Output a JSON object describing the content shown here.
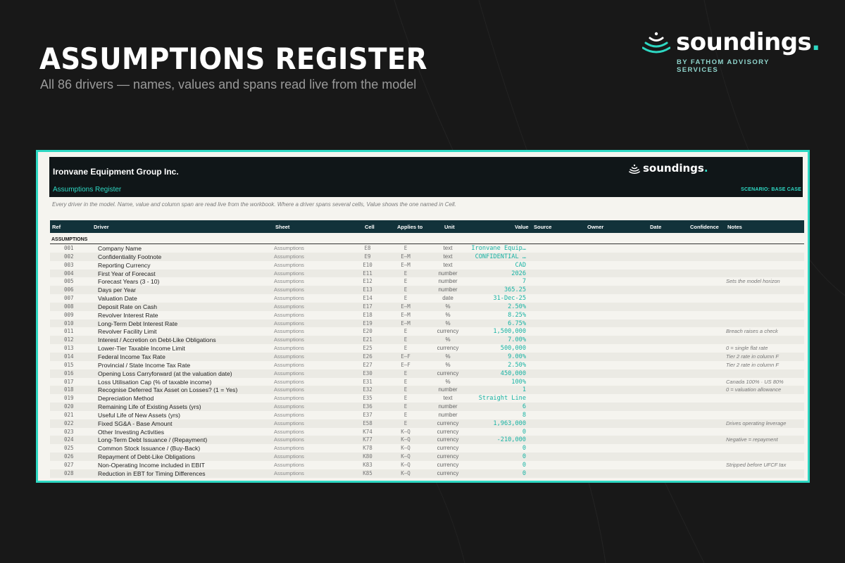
{
  "hero": {
    "title": "ASSUMPTIONS REGISTER",
    "subtitle": "All 86 drivers — names, values and spans read live from the model"
  },
  "brand": {
    "word": "soundings",
    "dot": ".",
    "sub": "BY FATHOM ADVISORY SERVICES",
    "icon": "sound-waves-icon",
    "accent": "#2ed8c3"
  },
  "sheet": {
    "company": "Ironvane Equipment Group Inc.",
    "register_link": "Assumptions Register",
    "scenario": "SCENARIO: BASE CASE",
    "note": "Every driver in the model. Name, value and column span are read live from the workbook. Where a driver spans several cells, Value shows the one named in Cell.",
    "columns": {
      "ref": "Ref",
      "driver": "Driver",
      "sheet": "Sheet",
      "cell": "Cell",
      "applies": "Applies to",
      "unit": "Unit",
      "value": "Value",
      "source": "Source",
      "owner": "Owner",
      "date": "Date",
      "confidence": "Confidence",
      "notes": "Notes"
    },
    "section": "ASSUMPTIONS",
    "rows": [
      {
        "ref": "001",
        "driver": "Company Name",
        "sheet": "Assumptions",
        "cell": "E8",
        "applies": "E",
        "unit": "text",
        "value": "Ironvane Equip…",
        "notes": ""
      },
      {
        "ref": "002",
        "driver": "Confidentiality Footnote",
        "sheet": "Assumptions",
        "cell": "E9",
        "applies": "E–M",
        "unit": "text",
        "value": "CONFIDENTIAL  …",
        "notes": ""
      },
      {
        "ref": "003",
        "driver": "Reporting Currency",
        "sheet": "Assumptions",
        "cell": "E10",
        "applies": "E–M",
        "unit": "text",
        "value": "CAD",
        "notes": ""
      },
      {
        "ref": "004",
        "driver": "First Year of Forecast",
        "sheet": "Assumptions",
        "cell": "E11",
        "applies": "E",
        "unit": "number",
        "value": "2026",
        "notes": ""
      },
      {
        "ref": "005",
        "driver": "Forecast Years  (3 - 10)",
        "sheet": "Assumptions",
        "cell": "E12",
        "applies": "E",
        "unit": "number",
        "value": "7",
        "notes": "Sets the model horizon"
      },
      {
        "ref": "006",
        "driver": "Days per Year",
        "sheet": "Assumptions",
        "cell": "E13",
        "applies": "E",
        "unit": "number",
        "value": "365.25",
        "notes": ""
      },
      {
        "ref": "007",
        "driver": "Valuation Date",
        "sheet": "Assumptions",
        "cell": "E14",
        "applies": "E",
        "unit": "date",
        "value": "31-Dec-25",
        "notes": ""
      },
      {
        "ref": "008",
        "driver": "Deposit Rate on Cash",
        "sheet": "Assumptions",
        "cell": "E17",
        "applies": "E–M",
        "unit": "%",
        "value": "2.50%",
        "notes": ""
      },
      {
        "ref": "009",
        "driver": "Revolver Interest Rate",
        "sheet": "Assumptions",
        "cell": "E18",
        "applies": "E–M",
        "unit": "%",
        "value": "8.25%",
        "notes": ""
      },
      {
        "ref": "010",
        "driver": "Long-Term Debt Interest Rate",
        "sheet": "Assumptions",
        "cell": "E19",
        "applies": "E–M",
        "unit": "%",
        "value": "6.75%",
        "notes": ""
      },
      {
        "ref": "011",
        "driver": "Revolver Facility Limit",
        "sheet": "Assumptions",
        "cell": "E20",
        "applies": "E",
        "unit": "currency",
        "value": "1,500,000",
        "notes": "Breach raises a check"
      },
      {
        "ref": "012",
        "driver": "Interest / Accretion on Debt-Like Obligations",
        "sheet": "Assumptions",
        "cell": "E21",
        "applies": "E",
        "unit": "%",
        "value": "7.00%",
        "notes": ""
      },
      {
        "ref": "013",
        "driver": "Lower-Tier Taxable Income Limit",
        "sheet": "Assumptions",
        "cell": "E25",
        "applies": "E",
        "unit": "currency",
        "value": "500,000",
        "notes": "0 = single flat rate"
      },
      {
        "ref": "014",
        "driver": "Federal Income Tax Rate",
        "sheet": "Assumptions",
        "cell": "E26",
        "applies": "E–F",
        "unit": "%",
        "value": "9.00%",
        "notes": "Tier 2 rate in column F"
      },
      {
        "ref": "015",
        "driver": "Provincial / State Income Tax Rate",
        "sheet": "Assumptions",
        "cell": "E27",
        "applies": "E–F",
        "unit": "%",
        "value": "2.50%",
        "notes": "Tier 2 rate in column F"
      },
      {
        "ref": "016",
        "driver": "Opening Loss Carryforward  (at the valuation date)",
        "sheet": "Assumptions",
        "cell": "E30",
        "applies": "E",
        "unit": "currency",
        "value": "450,000",
        "notes": ""
      },
      {
        "ref": "017",
        "driver": "Loss Utilisation Cap  (% of taxable income)",
        "sheet": "Assumptions",
        "cell": "E31",
        "applies": "E",
        "unit": "%",
        "value": "100%",
        "notes": "Canada 100% · US 80%"
      },
      {
        "ref": "018",
        "driver": "Recognise Deferred Tax Asset on Losses?  (1 = Yes)",
        "sheet": "Assumptions",
        "cell": "E32",
        "applies": "E",
        "unit": "number",
        "value": "1",
        "notes": "0 = valuation allowance"
      },
      {
        "ref": "019",
        "driver": "Depreciation Method",
        "sheet": "Assumptions",
        "cell": "E35",
        "applies": "E",
        "unit": "text",
        "value": "Straight Line",
        "notes": ""
      },
      {
        "ref": "020",
        "driver": "Remaining Life of Existing Assets  (yrs)",
        "sheet": "Assumptions",
        "cell": "E36",
        "applies": "E",
        "unit": "number",
        "value": "6",
        "notes": ""
      },
      {
        "ref": "021",
        "driver": "Useful Life of New Assets  (yrs)",
        "sheet": "Assumptions",
        "cell": "E37",
        "applies": "E",
        "unit": "number",
        "value": "8",
        "notes": ""
      },
      {
        "ref": "022",
        "driver": "Fixed SG&A - Base Amount",
        "sheet": "Assumptions",
        "cell": "E58",
        "applies": "E",
        "unit": "currency",
        "value": "1,963,000",
        "notes": "Drives operating leverage"
      },
      {
        "ref": "023",
        "driver": "Other Investing Activities",
        "sheet": "Assumptions",
        "cell": "K74",
        "applies": "K–Q",
        "unit": "currency",
        "value": "0",
        "notes": ""
      },
      {
        "ref": "024",
        "driver": "Long-Term Debt Issuance / (Repayment)",
        "sheet": "Assumptions",
        "cell": "K77",
        "applies": "K–Q",
        "unit": "currency",
        "value": "-210,000",
        "notes": "Negative = repayment"
      },
      {
        "ref": "025",
        "driver": "Common Stock Issuance / (Buy-Back)",
        "sheet": "Assumptions",
        "cell": "K78",
        "applies": "K–Q",
        "unit": "currency",
        "value": "0",
        "notes": ""
      },
      {
        "ref": "026",
        "driver": "Repayment of Debt-Like Obligations",
        "sheet": "Assumptions",
        "cell": "K80",
        "applies": "K–Q",
        "unit": "currency",
        "value": "0",
        "notes": ""
      },
      {
        "ref": "027",
        "driver": "Non-Operating Income included in EBIT",
        "sheet": "Assumptions",
        "cell": "K83",
        "applies": "K–Q",
        "unit": "currency",
        "value": "0",
        "notes": "Stripped before UFCF tax"
      },
      {
        "ref": "028",
        "driver": "Reduction in EBT for Timing Differences",
        "sheet": "Assumptions",
        "cell": "K85",
        "applies": "K–Q",
        "unit": "currency",
        "value": "0",
        "notes": ""
      }
    ]
  }
}
